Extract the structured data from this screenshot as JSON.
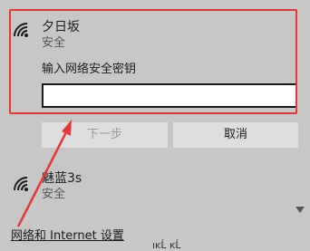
{
  "networks": [
    {
      "name": "夕日坂",
      "security": "安全",
      "icon": "wifi-icon"
    },
    {
      "name": "魅蓝3s",
      "security": "安全",
      "icon": "wifi-icon"
    }
  ],
  "connect": {
    "key_label": "输入网络安全密钥",
    "key_value": "",
    "next_label": "下一步",
    "cancel_label": "取消"
  },
  "settings_link": "网络和 Internet 设置",
  "bottom_partial": "ıĸĹ ĸĹ",
  "colors": {
    "highlight": "#e03a3a",
    "arrow": "#e03a3a",
    "panel_bg": "#c9c7c6"
  }
}
